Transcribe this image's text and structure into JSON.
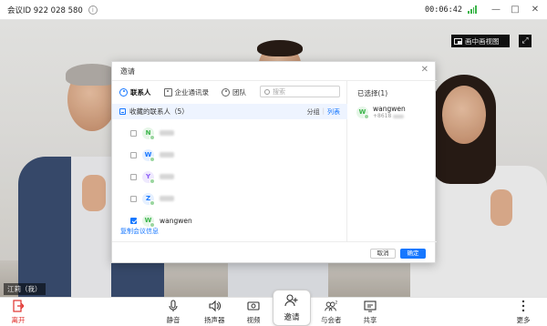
{
  "titlebar": {
    "meeting_id": "会议ID 922 028 580",
    "info_icon": "info-icon",
    "timer": "00:06:42",
    "signal_color": "#3bb54a"
  },
  "video": {
    "pip_label": "画中画视图",
    "speaker_name": "江莉（我）"
  },
  "dialog": {
    "title": "邀请",
    "tabs": [
      {
        "label": "联系人",
        "icon": "person-icon",
        "active": true
      },
      {
        "label": "企业通讯录",
        "icon": "directory-icon",
        "active": false
      },
      {
        "label": "团队",
        "icon": "team-icon",
        "active": false
      }
    ],
    "search_placeholder": "搜索",
    "favorites": {
      "label": "收藏的联系人（5）",
      "group_label": "分组",
      "list_label": "列表"
    },
    "contacts": [
      {
        "avatar_letter": "N",
        "avatar_color": "#3bb54a",
        "avatar_bg": "#e6f6e8",
        "name": "",
        "checked": false
      },
      {
        "avatar_letter": "W",
        "avatar_color": "#1677ff",
        "avatar_bg": "#e6f0ff",
        "name": "",
        "checked": false
      },
      {
        "avatar_letter": "Y",
        "avatar_color": "#8b5cf6",
        "avatar_bg": "#efe9fe",
        "name": "",
        "checked": false
      },
      {
        "avatar_letter": "Z",
        "avatar_color": "#1677ff",
        "avatar_bg": "#e6f0ff",
        "name": "",
        "checked": false
      },
      {
        "avatar_letter": "W",
        "avatar_color": "#3bb54a",
        "avatar_bg": "#e6f6e8",
        "name": "wangwen",
        "checked": true
      }
    ],
    "selected_title": "已选择(1)",
    "selected": [
      {
        "avatar_letter": "W",
        "name": "wangwen",
        "phone": "+8618"
      }
    ],
    "copy_link": "复制会议信息",
    "cancel": "取消",
    "confirm": "确定",
    "accent": "#1677ff"
  },
  "toolbar": {
    "leave": "离开",
    "mute": "静音",
    "speaker": "扬声器",
    "video": "视频",
    "invite": "邀请",
    "participants": "与会者",
    "participants_count": "2",
    "share": "共享",
    "more": "更多",
    "leave_color": "#e0312c"
  }
}
